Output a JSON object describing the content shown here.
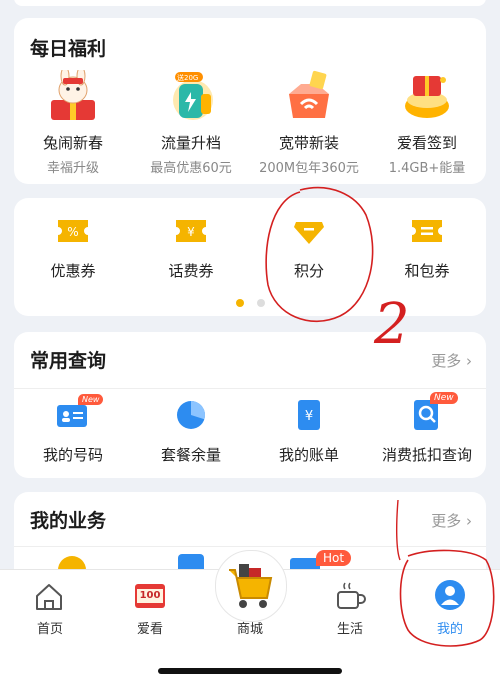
{
  "daily": {
    "title": "每日福利",
    "items": [
      {
        "label": "兔闹新春",
        "sub": "幸福升级",
        "icon": "rabbit-gift-icon"
      },
      {
        "label": "流量升档",
        "sub": "最高优惠60元",
        "icon": "data-boost-icon",
        "badge": "送20G"
      },
      {
        "label": "宽带新装",
        "sub": "200M包年360元",
        "icon": "broadband-box-icon"
      },
      {
        "label": "爱看签到",
        "sub": "1.4GB+能量",
        "icon": "checkin-gift-icon"
      }
    ]
  },
  "coupons": {
    "items": [
      {
        "label": "优惠券",
        "icon": "discount-ticket-icon"
      },
      {
        "label": "话费券",
        "icon": "yuan-ticket-icon"
      },
      {
        "label": "积分",
        "icon": "diamond-icon"
      },
      {
        "label": "和包券",
        "icon": "package-ticket-icon"
      }
    ]
  },
  "common": {
    "title": "常用查询",
    "more": "更多",
    "items": [
      {
        "label": "我的号码",
        "icon": "id-card-icon",
        "badge": "New"
      },
      {
        "label": "套餐余量",
        "icon": "pie-chart-icon"
      },
      {
        "label": "我的账单",
        "icon": "bill-icon"
      },
      {
        "label": "消费抵扣查询",
        "icon": "search-doc-icon",
        "badge": "New"
      }
    ]
  },
  "business": {
    "title": "我的业务",
    "more": "更多",
    "hot": "Hot"
  },
  "nav": {
    "items": [
      {
        "label": "首页",
        "icon": "home-icon"
      },
      {
        "label": "爱看",
        "icon": "tv-icon",
        "badge": "100"
      },
      {
        "label": "商城",
        "icon": "shopping-cart-icon"
      },
      {
        "label": "生活",
        "icon": "coffee-cup-icon"
      },
      {
        "label": "我的",
        "icon": "user-icon"
      }
    ]
  },
  "annotation": {
    "number": "2"
  },
  "colors": {
    "accent": "#f5b400",
    "blue": "#2d8cf0",
    "nav_active": "#2d8cf0",
    "pen": "#d42020"
  }
}
